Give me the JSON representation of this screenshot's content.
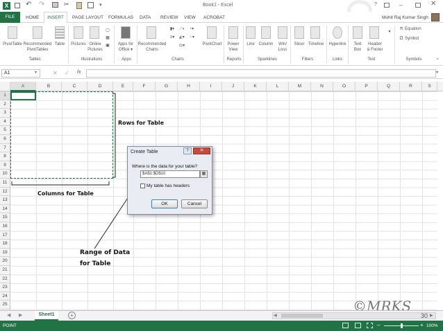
{
  "window": {
    "title": "Book1 - Excel",
    "user": "Mohit Raj Kumar Singh"
  },
  "tabs": [
    "FILE",
    "HOME",
    "INSERT",
    "PAGE LAYOUT",
    "FORMULAS",
    "DATA",
    "REVIEW",
    "VIEW",
    "ACROBAT"
  ],
  "active_tab": "INSERT",
  "ribbon": {
    "buttons": {
      "pivottable": "PivotTable",
      "recommended_pivottables": "Recommended\nPivotTables",
      "table": "Table",
      "pictures": "Pictures",
      "online_pictures": "Online\nPictures",
      "apps_for_office": "Apps for\nOffice",
      "recommended_charts": "Recommended\nCharts",
      "pivotchart": "PivotChart",
      "power_view": "Power\nView",
      "line": "Line",
      "column": "Column",
      "winloss": "Win/\nLoss",
      "slicer": "Slicer",
      "timeline": "Timeline",
      "hyperlink": "Hyperlink",
      "text_box": "Text\nBox",
      "header_footer": "Header\n& Footer",
      "equation": "Equation",
      "symbol": "Symbol"
    },
    "groups": [
      "Tables",
      "Illustrations",
      "Apps",
      "Charts",
      "Reports",
      "Sparklines",
      "Filters",
      "Links",
      "Text",
      "Symbols"
    ]
  },
  "formula_bar": {
    "name_box": "A1",
    "fx": "fx",
    "formula": ""
  },
  "columns": [
    "A",
    "B",
    "C",
    "D",
    "E",
    "F",
    "G",
    "H",
    "I",
    "J",
    "K",
    "L",
    "M",
    "N",
    "O",
    "P",
    "Q",
    "R",
    "S"
  ],
  "rows": [
    "1",
    "2",
    "3",
    "4",
    "5",
    "6",
    "7",
    "8",
    "9",
    "10",
    "11",
    "12",
    "13",
    "14",
    "15",
    "16",
    "17",
    "18",
    "19",
    "20",
    "21",
    "22",
    "23",
    "24",
    "25"
  ],
  "annotations": {
    "rows_for_table": "Rows for Table",
    "columns_for_table": "Columns for Table",
    "range_line1": "Range of Data",
    "range_line2": "for Table",
    "watermark": "©MRKS"
  },
  "dialog": {
    "title": "Create Table",
    "question": "Where is the data for your table?",
    "range_value": "$A$1:$D$10",
    "checkbox_label": "My table has headers",
    "checkbox_checked": false,
    "ok": "OK",
    "cancel": "Cancel"
  },
  "sheet_tabs": [
    "Sheet1"
  ],
  "status": {
    "mode": "POINT",
    "zoom": "100%",
    "page_count": "30"
  },
  "colors": {
    "excel_green": "#217346",
    "selection_dash": "#217346",
    "dialog_bg": "#e9edf3"
  }
}
